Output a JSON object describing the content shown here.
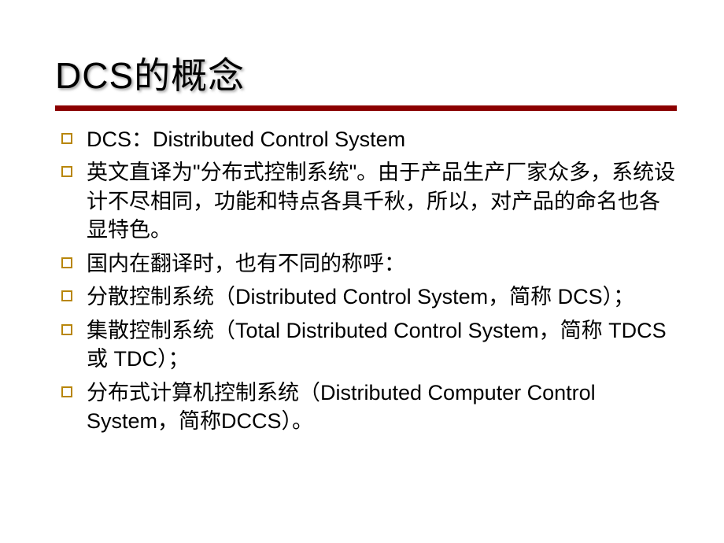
{
  "title": "DCS的概念",
  "bullets": [
    "DCS：Distributed Control System",
    "英文直译为\"分布式控制系统\"。由于产品生产厂家众多，系统设计不尽相同，功能和特点各具千秋，所以，对产品的命名也各显特色。",
    "国内在翻译时，也有不同的称呼：",
    "分散控制系统（Distributed Control System，简称 DCS）；",
    "集散控制系统（Total Distributed Control System，简称 TDCS或 TDC）；",
    "分布式计算机控制系统（Distributed Computer Control System，简称DCCS）。"
  ]
}
